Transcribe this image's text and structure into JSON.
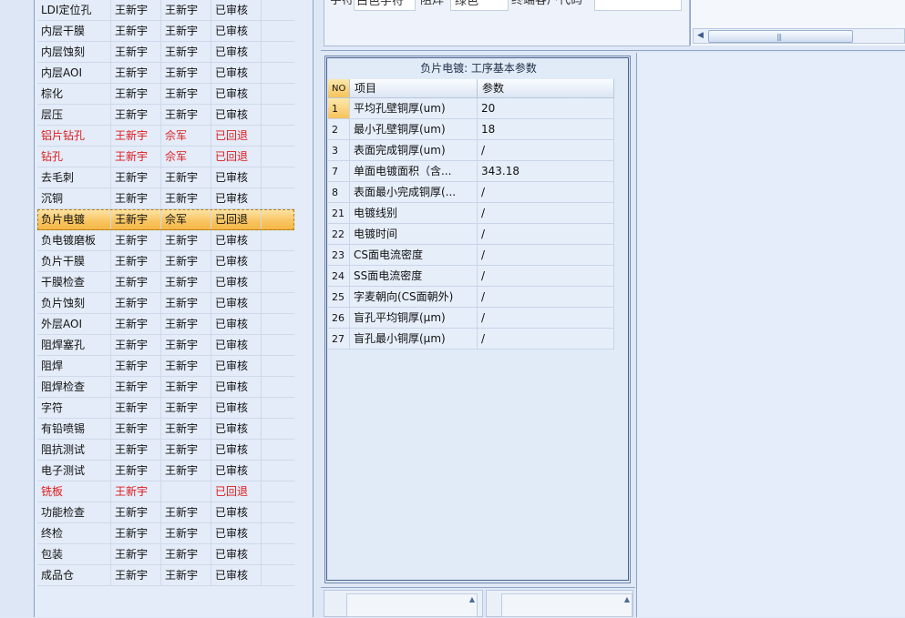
{
  "process_list": {
    "rows": [
      {
        "name": "LDI定位孔",
        "c1": "王新宇",
        "c2": "王新宇",
        "status": "已审核"
      },
      {
        "name": "内层干膜",
        "c1": "王新宇",
        "c2": "王新宇",
        "status": "已审核"
      },
      {
        "name": "内层蚀刻",
        "c1": "王新宇",
        "c2": "王新宇",
        "status": "已审核"
      },
      {
        "name": "内层AOI",
        "c1": "王新宇",
        "c2": "王新宇",
        "status": "已审核"
      },
      {
        "name": "棕化",
        "c1": "王新宇",
        "c2": "王新宇",
        "status": "已审核"
      },
      {
        "name": "层压",
        "c1": "王新宇",
        "c2": "王新宇",
        "status": "已审核"
      },
      {
        "name": "铝片钻孔",
        "c1": "王新宇",
        "c2": "佘军",
        "status": "已回退"
      },
      {
        "name": "钻孔",
        "c1": "王新宇",
        "c2": "佘军",
        "status": "已回退"
      },
      {
        "name": "去毛刺",
        "c1": "王新宇",
        "c2": "王新宇",
        "status": "已审核"
      },
      {
        "name": "沉铜",
        "c1": "王新宇",
        "c2": "王新宇",
        "status": "已审核"
      },
      {
        "name": "负片电镀",
        "c1": "王新宇",
        "c2": "佘军",
        "status": "已回退"
      },
      {
        "name": "负电镀磨板",
        "c1": "王新宇",
        "c2": "王新宇",
        "status": "已审核"
      },
      {
        "name": "负片干膜",
        "c1": "王新宇",
        "c2": "王新宇",
        "status": "已审核"
      },
      {
        "name": "干膜检查",
        "c1": "王新宇",
        "c2": "王新宇",
        "status": "已审核"
      },
      {
        "name": "负片蚀刻",
        "c1": "王新宇",
        "c2": "王新宇",
        "status": "已审核"
      },
      {
        "name": "外层AOI",
        "c1": "王新宇",
        "c2": "王新宇",
        "status": "已审核"
      },
      {
        "name": "阻焊塞孔",
        "c1": "王新宇",
        "c2": "王新宇",
        "status": "已审核"
      },
      {
        "name": "阻焊",
        "c1": "王新宇",
        "c2": "王新宇",
        "status": "已审核"
      },
      {
        "name": "阻焊检查",
        "c1": "王新宇",
        "c2": "王新宇",
        "status": "已审核"
      },
      {
        "name": "字符",
        "c1": "王新宇",
        "c2": "王新宇",
        "status": "已审核"
      },
      {
        "name": "有铅喷锡",
        "c1": "王新宇",
        "c2": "王新宇",
        "status": "已审核"
      },
      {
        "name": "阻抗测试",
        "c1": "王新宇",
        "c2": "王新宇",
        "status": "已审核"
      },
      {
        "name": "电子测试",
        "c1": "王新宇",
        "c2": "王新宇",
        "status": "已审核"
      },
      {
        "name": "铣板",
        "c1": "王新宇",
        "c2": "",
        "status": "已回退"
      },
      {
        "name": "功能检查",
        "c1": "王新宇",
        "c2": "王新宇",
        "status": "已审核"
      },
      {
        "name": "终检",
        "c1": "王新宇",
        "c2": "王新宇",
        "status": "已审核"
      },
      {
        "name": "包装",
        "c1": "王新宇",
        "c2": "王新宇",
        "status": "已审核"
      },
      {
        "name": "成品仓",
        "c1": "王新宇",
        "c2": "王新宇",
        "status": "已审核"
      }
    ],
    "red_rows": [
      6,
      7,
      23
    ],
    "selected_row": 10
  },
  "top_form": {
    "label1": "字符",
    "value1": "白色字符",
    "label2": "阻焊",
    "value2": "绿色",
    "label3": "终端客户代码",
    "value3": ""
  },
  "params": {
    "title": "负片电镀: 工序基本参数",
    "headers": {
      "no": "NO",
      "item": "项目",
      "value": "参数"
    },
    "rows": [
      {
        "no": "1",
        "item": "平均孔壁铜厚(um)",
        "value": "20"
      },
      {
        "no": "2",
        "item": "最小孔壁铜厚(um)",
        "value": "18"
      },
      {
        "no": "3",
        "item": "表面完成铜厚(um)",
        "value": "/"
      },
      {
        "no": "7",
        "item": "单面电镀面积（含...",
        "value": "343.18"
      },
      {
        "no": "8",
        "item": "表面最小完成铜厚(...",
        "value": "/"
      },
      {
        "no": "21",
        "item": "电镀线别",
        "value": "/"
      },
      {
        "no": "22",
        "item": "电镀时间",
        "value": "/"
      },
      {
        "no": "23",
        "item": "CS面电流密度",
        "value": "/"
      },
      {
        "no": "24",
        "item": "SS面电流密度",
        "value": "/"
      },
      {
        "no": "25",
        "item": "字麦朝向(CS面朝外)",
        "value": "/"
      },
      {
        "no": "26",
        "item": "盲孔平均铜厚(μm)",
        "value": "/"
      },
      {
        "no": "27",
        "item": "盲孔最小铜厚(μm)",
        "value": "/"
      }
    ],
    "current_row": 0
  },
  "colors": {
    "highlight": "#f8c563",
    "rejected_text": "#e0191b",
    "panel": "#dfe8f6"
  }
}
